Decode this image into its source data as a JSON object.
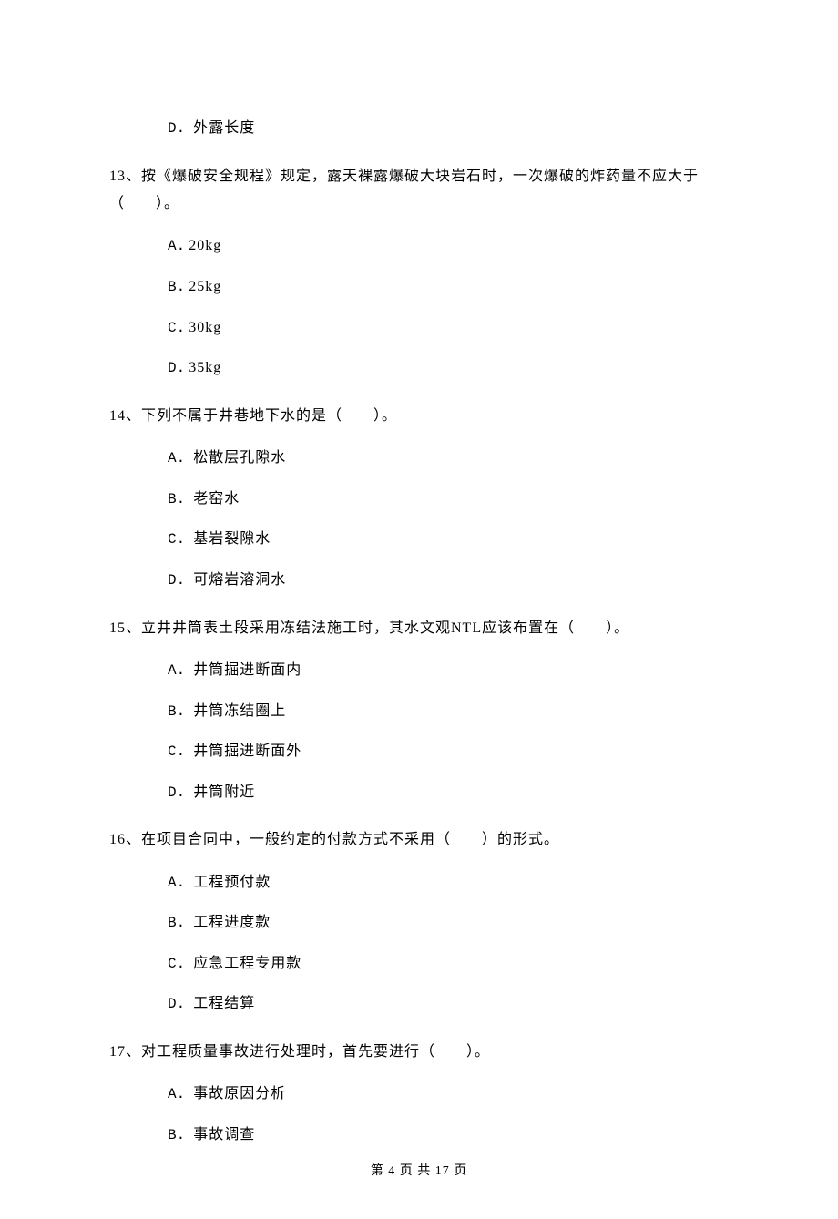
{
  "q12_remaining": {
    "D": "外露长度"
  },
  "q13": {
    "stem": "13、按《爆破安全规程》规定，露天裸露爆破大块岩石时，一次爆破的炸药量不应大于（　　）。",
    "A": "20kg",
    "B": "25kg",
    "C": "30kg",
    "D": "35kg"
  },
  "q14": {
    "stem": "14、下列不属于井巷地下水的是（　　）。",
    "A": "松散层孔隙水",
    "B": "老窑水",
    "C": "基岩裂隙水",
    "D": "可熔岩溶洞水"
  },
  "q15": {
    "stem": "15、立井井筒表土段采用冻结法施工时，其水文观NTL应该布置在（　　）。",
    "A": "井筒掘进断面内",
    "B": "井筒冻结圈上",
    "C": "井筒掘进断面外",
    "D": "井筒附近"
  },
  "q16": {
    "stem": "16、在项目合同中，一般约定的付款方式不采用（　　）的形式。",
    "A": "工程预付款",
    "B": "工程进度款",
    "C": "应急工程专用款",
    "D": "工程结算"
  },
  "q17": {
    "stem": "17、对工程质量事故进行处理时，首先要进行（　　）。",
    "A": "事故原因分析",
    "B": "事故调查"
  },
  "footer": "第 4 页 共 17 页"
}
